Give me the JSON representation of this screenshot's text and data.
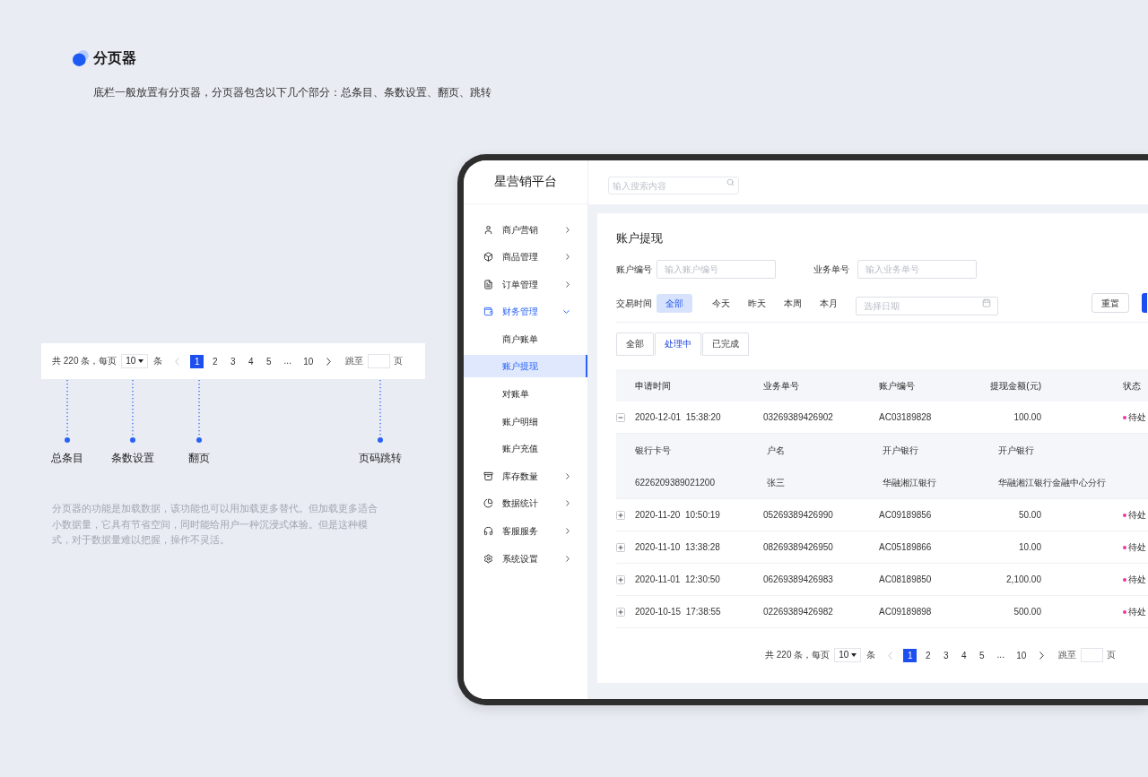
{
  "section": {
    "title": "分页器",
    "description": "底栏一般放置有分页器，分页器包含以下几个部分：总条目、条数设置、翻页、跳转"
  },
  "pagination_demo": {
    "total_text": "共 220 条，每页",
    "page_size": "10",
    "unit": "条",
    "prev": {
      "disabled": true
    },
    "pages": [
      {
        "kind": "page",
        "label": "1",
        "selected": true
      },
      {
        "kind": "page",
        "label": "2",
        "selected": false
      },
      {
        "kind": "page",
        "label": "3",
        "selected": false
      },
      {
        "kind": "page",
        "label": "4",
        "selected": false
      },
      {
        "kind": "page",
        "label": "5",
        "selected": false
      },
      {
        "kind": "ellipsis",
        "label": "..."
      },
      {
        "kind": "page",
        "label": "10",
        "selected": false
      }
    ],
    "next": {
      "disabled": false
    },
    "jump_label": "跳至",
    "page_unit": "页"
  },
  "annotations": [
    {
      "label": "总条目"
    },
    {
      "label": "条数设置"
    },
    {
      "label": "翻页"
    },
    {
      "label": "页码跳转"
    }
  ],
  "note": "分页器的功能是加载数据，该功能也可以用加载更多替代。但加载更多适合小数据量，它具有节省空间，同时能给用户一种沉浸式体验。但是这种模式，对于数据量难以把握，操作不灵活。",
  "app": {
    "brand": "星营销平台",
    "search": {
      "placeholder": "输入搜索内容"
    },
    "sidebar": {
      "items": [
        {
          "label": "商户营销",
          "expanded": false
        },
        {
          "label": "商品管理",
          "expanded": false
        },
        {
          "label": "订单管理",
          "expanded": false
        },
        {
          "label": "财务管理",
          "expanded": true,
          "children": [
            {
              "label": "商户账单",
              "selected": false
            },
            {
              "label": "账户提现",
              "selected": true
            },
            {
              "label": "对账单",
              "selected": false
            },
            {
              "label": "账户明细",
              "selected": false
            },
            {
              "label": "账户充值",
              "selected": false
            }
          ]
        },
        {
          "label": "库存数量",
          "expanded": false
        },
        {
          "label": "数据统计",
          "expanded": false
        },
        {
          "label": "客服服务",
          "expanded": false
        },
        {
          "label": "系统设置",
          "expanded": false
        }
      ]
    },
    "page_title": "账户提现",
    "fields": [
      {
        "label": "账户编号",
        "placeholder": "输入账户编号"
      },
      {
        "label": "业务单号",
        "placeholder": "输入业务单号"
      }
    ],
    "time_filter": {
      "label": "交易时间",
      "options": [
        {
          "label": "全部",
          "selected": true
        },
        {
          "label": "今天",
          "selected": false
        },
        {
          "label": "昨天",
          "selected": false
        },
        {
          "label": "本周",
          "selected": false
        },
        {
          "label": "本月",
          "selected": false
        }
      ],
      "date_placeholder": "选择日期"
    },
    "buttons": [
      {
        "kind": "default",
        "label": "重置"
      },
      {
        "kind": "primary"
      }
    ],
    "status_tabs": [
      {
        "label": "全部",
        "selected": false
      },
      {
        "label": "处理中",
        "selected": true
      },
      {
        "label": "已完成",
        "selected": false
      }
    ],
    "table": {
      "columns": [
        "申请时间",
        "业务单号",
        "账户编号",
        "提现金额(元)",
        "状态"
      ],
      "rows": [
        {
          "expanded": true,
          "time": "2020-12-01  15:38:20",
          "order_no": "03269389426902",
          "account_no": "AC03189828",
          "amount": "100.00",
          "status": "待处",
          "detail": {
            "labels": [
              "银行卡号",
              "户名",
              "开户银行",
              "开户银行"
            ],
            "values": [
              "6226209389021200",
              "张三",
              "华融湘江银行",
              "华融湘江银行金融中心分行"
            ]
          }
        },
        {
          "expanded": false,
          "time": "2020-11-20  10:50:19",
          "order_no": "05269389426990",
          "account_no": "AC09189856",
          "amount": "50.00",
          "status": "待处"
        },
        {
          "expanded": false,
          "time": "2020-11-10  13:38:28",
          "order_no": "08269389426950",
          "account_no": "AC05189866",
          "amount": "10.00",
          "status": "待处"
        },
        {
          "expanded": false,
          "time": "2020-11-01  12:30:50",
          "order_no": "06269389426983",
          "account_no": "AC08189850",
          "amount": "2,100.00",
          "status": "待处"
        },
        {
          "expanded": false,
          "time": "2020-10-15  17:38:55",
          "order_no": "02269389426982",
          "account_no": "AC09189898",
          "amount": "500.00",
          "status": "待处"
        }
      ]
    },
    "pagination": {
      "total_text": "共 220 条，每页",
      "page_size": "10",
      "unit": "条",
      "prev": {
        "disabled": true
      },
      "pages": [
        {
          "kind": "page",
          "label": "1",
          "selected": true
        },
        {
          "kind": "page",
          "label": "2",
          "selected": false
        },
        {
          "kind": "page",
          "label": "3",
          "selected": false
        },
        {
          "kind": "page",
          "label": "4",
          "selected": false
        },
        {
          "kind": "page",
          "label": "5",
          "selected": false
        },
        {
          "kind": "ellipsis",
          "label": "..."
        },
        {
          "kind": "page",
          "label": "10",
          "selected": false
        }
      ],
      "next": {
        "disabled": false
      },
      "jump_label": "跳至",
      "page_unit": "页"
    }
  }
}
